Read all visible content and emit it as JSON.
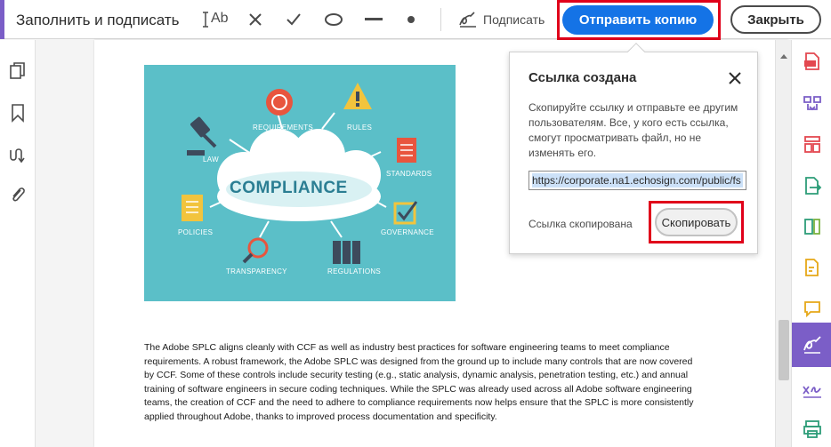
{
  "toolbar": {
    "title": "Заполнить и подписать",
    "tools": {
      "text": "Ab"
    },
    "sign_label": "Подписать",
    "send_copy_label": "Отправить копию",
    "close_label": "Закрыть"
  },
  "popover": {
    "title": "Ссылка создана",
    "description": "Скопируйте ссылку и отправьте ее другим пользователям. Все, у кого есть ссылка, смогут просматривать файл, но не изменять его.",
    "link": "https://corporate.na1.echosign.com/public/fs",
    "status": "Ссылка скопирована",
    "copy_label": "Скопировать"
  },
  "document": {
    "image": {
      "title": "COMPLIANCE",
      "labels": {
        "law": "LAW",
        "requirements": "REQUIREMENTS",
        "rules": "RULES",
        "standards": "STANDARDS",
        "policies": "POLICIES",
        "governance": "GOVERNANCE",
        "transparency": "TRANSPARENCY",
        "regulations": "REGULATIONS"
      }
    },
    "paragraph": "The Adobe SPLC aligns cleanly with CCF as well as industry best practices for software engineering teams to meet compliance requirements. A robust framework, the Adobe SPLC was designed from the ground up to include many controls that are now covered by CCF. Some of these controls include security testing (e.g., static analysis, dynamic analysis, penetration testing, etc.) and annual training of software engineers in secure coding techniques. While the SPLC was already used across all Adobe software engineering teams, the creation of CCF and the need to adhere to compliance requirements now helps ensure that the SPLC is more consistently applied throughout Adobe, thanks to improved process documentation and specificity."
  },
  "colors": {
    "accent": "#7b5ec7",
    "primary": "#1473e6",
    "highlight": "#e0001a",
    "image_bg": "#5bbfc8"
  }
}
